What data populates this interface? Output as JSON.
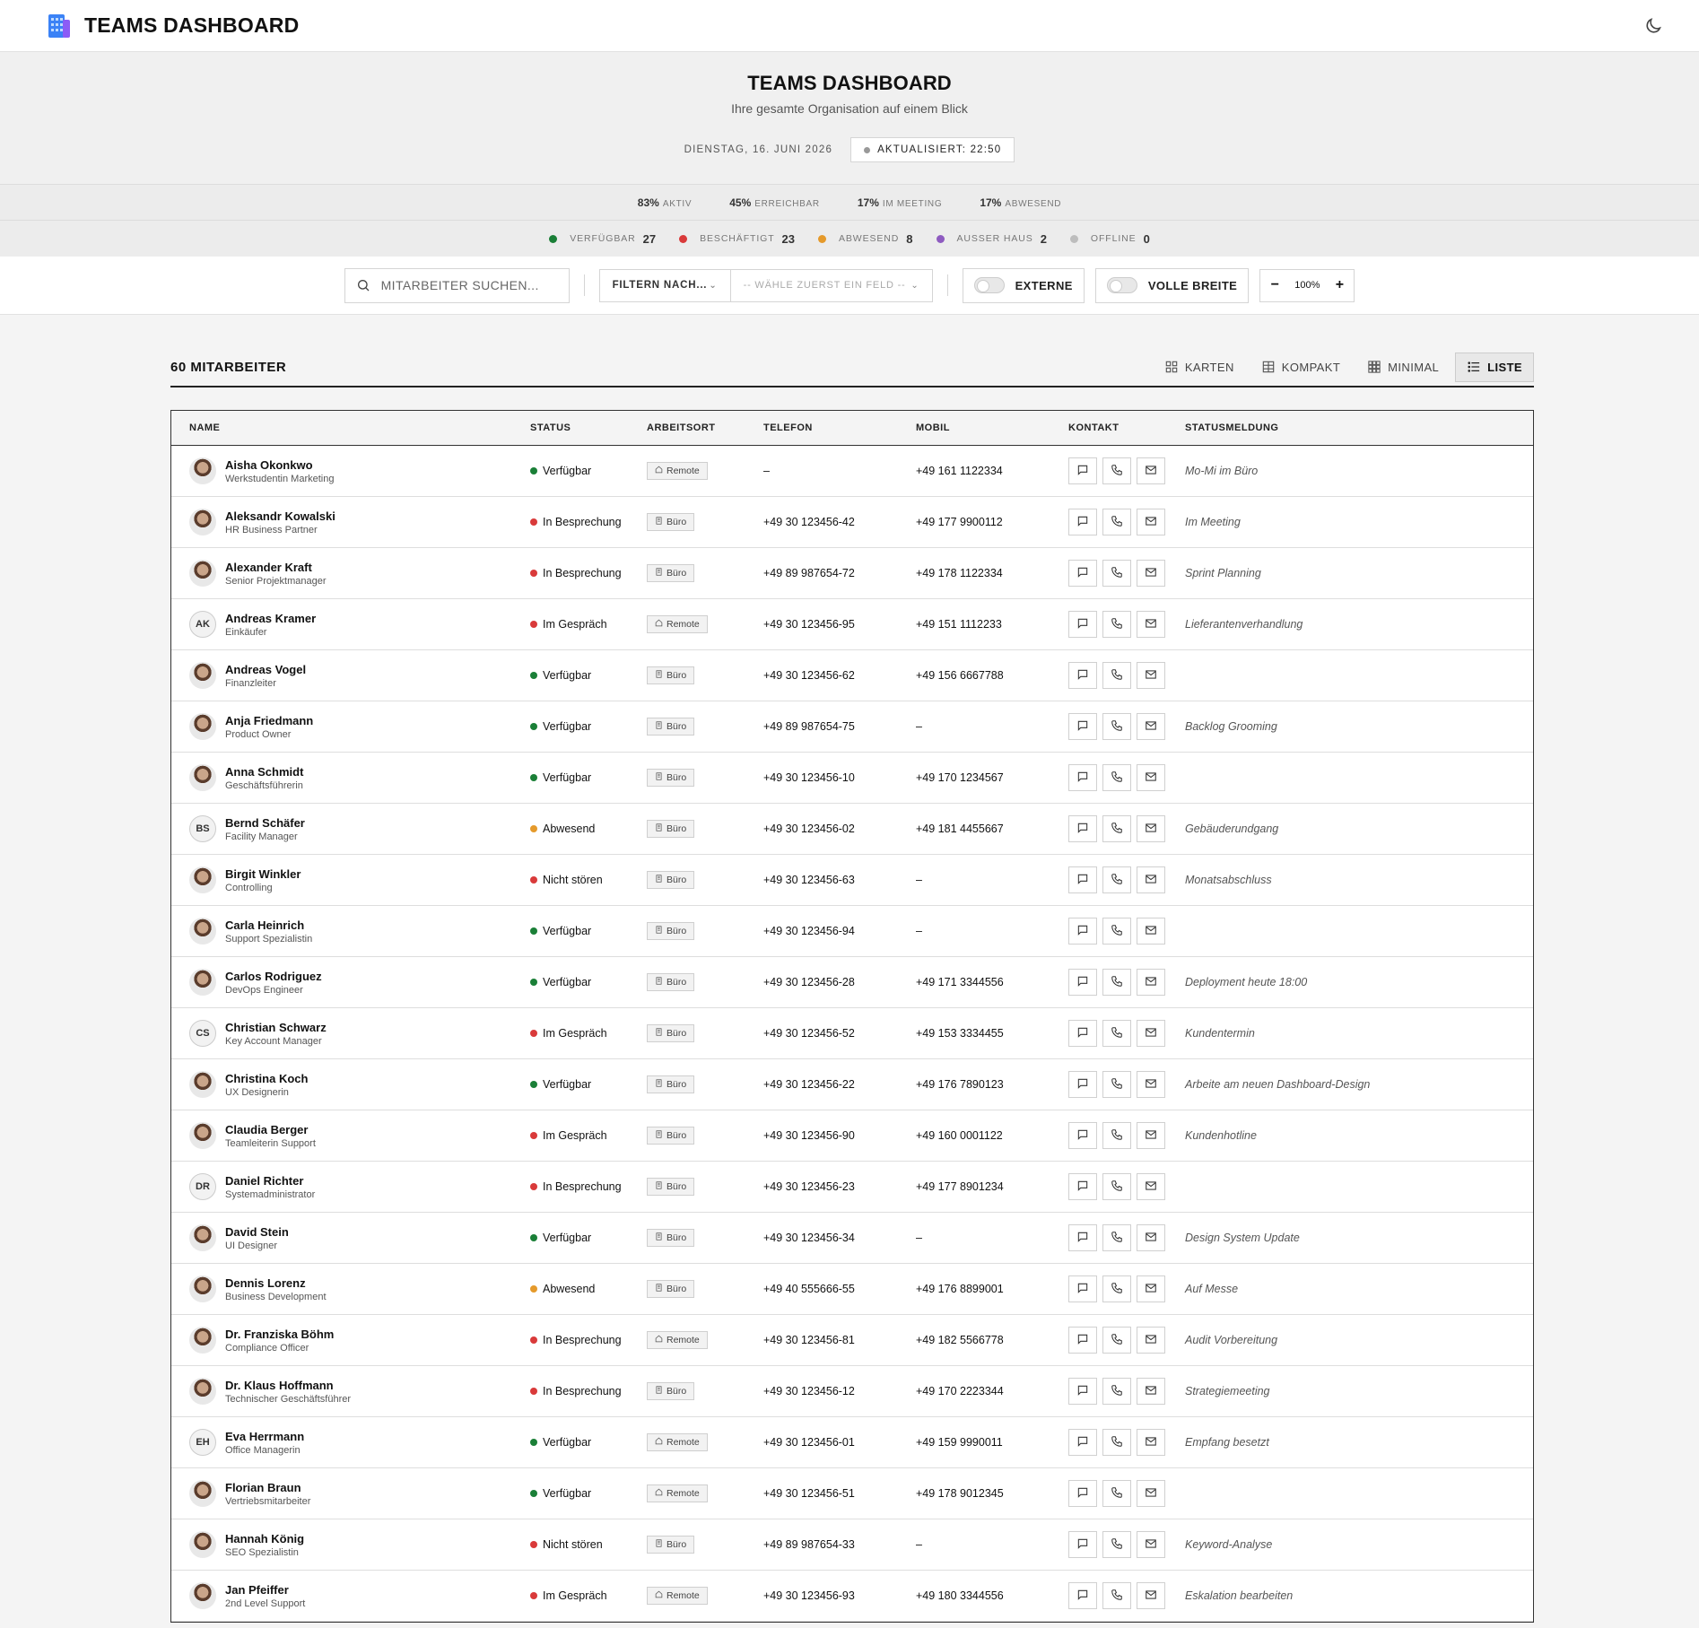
{
  "app": {
    "title": "TEAMS DASHBOARD"
  },
  "hero": {
    "title": "TEAMS DASHBOARD",
    "subtitle": "Ihre gesamte Organisation auf einem Blick",
    "date": "DIENSTAG, 16. JUNI 2026",
    "updated": "AKTUALISIERT: 22:50"
  },
  "stats": [
    {
      "pct": "83%",
      "label": "AKTIV"
    },
    {
      "pct": "45%",
      "label": "ERREICHBAR"
    },
    {
      "pct": "17%",
      "label": "IM MEETING"
    },
    {
      "pct": "17%",
      "label": "ABWESEND"
    }
  ],
  "status_counts": [
    {
      "label": "VERFÜGBAR",
      "count": "27",
      "color": "#1a7f37"
    },
    {
      "label": "BESCHÄFTIGT",
      "count": "23",
      "color": "#d93a3a"
    },
    {
      "label": "ABWESEND",
      "count": "8",
      "color": "#e59a2b"
    },
    {
      "label": "AUSSER HAUS",
      "count": "2",
      "color": "#8e5bc0"
    },
    {
      "label": "OFFLINE",
      "count": "0",
      "color": "#bdbdbd"
    }
  ],
  "toolbar": {
    "search_placeholder": "MITARBEITER SUCHEN...",
    "filter_label": "FILTERN NACH...",
    "filter_value": "-- WÄHLE ZUERST EIN FELD --",
    "externe_label": "EXTERNE",
    "fullwidth_label": "VOLLE BREITE",
    "zoom": "100%",
    "zoom_minus": "−",
    "zoom_plus": "+"
  },
  "list": {
    "count_label": "60 MITARBEITER",
    "views": [
      "KARTEN",
      "KOMPAKT",
      "MINIMAL",
      "LISTE"
    ],
    "active_view": "LISTE",
    "columns": [
      "NAME",
      "STATUS",
      "ARBEITSORT",
      "TELEFON",
      "MOBIL",
      "KONTAKT",
      "STATUSMELDUNG"
    ]
  },
  "status_colors": {
    "Verfügbar": "#1a7f37",
    "In Besprechung": "#d93a3a",
    "Im Gespräch": "#d93a3a",
    "Nicht stören": "#d93a3a",
    "Abwesend": "#e59a2b"
  },
  "rows": [
    {
      "name": "Aisha Okonkwo",
      "role": "Werkstudentin Marketing",
      "avatar": "photo",
      "initials": "",
      "status": "Verfügbar",
      "ort": "Remote",
      "tel": "–",
      "mob": "+49 161 1122334",
      "msg": "Mo-Mi im Büro"
    },
    {
      "name": "Aleksandr Kowalski",
      "role": "HR Business Partner",
      "avatar": "photo",
      "initials": "",
      "status": "In Besprechung",
      "ort": "Büro",
      "tel": "+49 30 123456-42",
      "mob": "+49 177 9900112",
      "msg": "Im Meeting"
    },
    {
      "name": "Alexander Kraft",
      "role": "Senior Projektmanager",
      "avatar": "photo",
      "initials": "",
      "status": "In Besprechung",
      "ort": "Büro",
      "tel": "+49 89 987654-72",
      "mob": "+49 178 1122334",
      "msg": "Sprint Planning"
    },
    {
      "name": "Andreas Kramer",
      "role": "Einkäufer",
      "avatar": "initials",
      "initials": "AK",
      "status": "Im Gespräch",
      "ort": "Remote",
      "tel": "+49 30 123456-95",
      "mob": "+49 151 1112233",
      "msg": "Lieferantenverhandlung"
    },
    {
      "name": "Andreas Vogel",
      "role": "Finanzleiter",
      "avatar": "photo",
      "initials": "",
      "status": "Verfügbar",
      "ort": "Büro",
      "tel": "+49 30 123456-62",
      "mob": "+49 156 6667788",
      "msg": ""
    },
    {
      "name": "Anja Friedmann",
      "role": "Product Owner",
      "avatar": "photo",
      "initials": "",
      "status": "Verfügbar",
      "ort": "Büro",
      "tel": "+49 89 987654-75",
      "mob": "–",
      "msg": "Backlog Grooming"
    },
    {
      "name": "Anna Schmidt",
      "role": "Geschäftsführerin",
      "avatar": "photo",
      "initials": "",
      "status": "Verfügbar",
      "ort": "Büro",
      "tel": "+49 30 123456-10",
      "mob": "+49 170 1234567",
      "msg": ""
    },
    {
      "name": "Bernd Schäfer",
      "role": "Facility Manager",
      "avatar": "initials",
      "initials": "BS",
      "status": "Abwesend",
      "ort": "Büro",
      "tel": "+49 30 123456-02",
      "mob": "+49 181 4455667",
      "msg": "Gebäuderundgang"
    },
    {
      "name": "Birgit Winkler",
      "role": "Controlling",
      "avatar": "photo",
      "initials": "",
      "status": "Nicht stören",
      "ort": "Büro",
      "tel": "+49 30 123456-63",
      "mob": "–",
      "msg": "Monatsabschluss"
    },
    {
      "name": "Carla Heinrich",
      "role": "Support Spezialistin",
      "avatar": "photo",
      "initials": "",
      "status": "Verfügbar",
      "ort": "Büro",
      "tel": "+49 30 123456-94",
      "mob": "–",
      "msg": ""
    },
    {
      "name": "Carlos Rodriguez",
      "role": "DevOps Engineer",
      "avatar": "photo",
      "initials": "",
      "status": "Verfügbar",
      "ort": "Büro",
      "tel": "+49 30 123456-28",
      "mob": "+49 171 3344556",
      "msg": "Deployment heute 18:00"
    },
    {
      "name": "Christian Schwarz",
      "role": "Key Account Manager",
      "avatar": "initials",
      "initials": "CS",
      "status": "Im Gespräch",
      "ort": "Büro",
      "tel": "+49 30 123456-52",
      "mob": "+49 153 3334455",
      "msg": "Kundentermin"
    },
    {
      "name": "Christina Koch",
      "role": "UX Designerin",
      "avatar": "photo",
      "initials": "",
      "status": "Verfügbar",
      "ort": "Büro",
      "tel": "+49 30 123456-22",
      "mob": "+49 176 7890123",
      "msg": "Arbeite am neuen Dashboard-Design"
    },
    {
      "name": "Claudia Berger",
      "role": "Teamleiterin Support",
      "avatar": "photo",
      "initials": "",
      "status": "Im Gespräch",
      "ort": "Büro",
      "tel": "+49 30 123456-90",
      "mob": "+49 160 0001122",
      "msg": "Kundenhotline"
    },
    {
      "name": "Daniel Richter",
      "role": "Systemadministrator",
      "avatar": "initials",
      "initials": "DR",
      "status": "In Besprechung",
      "ort": "Büro",
      "tel": "+49 30 123456-23",
      "mob": "+49 177 8901234",
      "msg": ""
    },
    {
      "name": "David Stein",
      "role": "UI Designer",
      "avatar": "photo",
      "initials": "",
      "status": "Verfügbar",
      "ort": "Büro",
      "tel": "+49 30 123456-34",
      "mob": "–",
      "msg": "Design System Update"
    },
    {
      "name": "Dennis Lorenz",
      "role": "Business Development",
      "avatar": "photo",
      "initials": "",
      "status": "Abwesend",
      "ort": "Büro",
      "tel": "+49 40 555666-55",
      "mob": "+49 176 8899001",
      "msg": "Auf Messe"
    },
    {
      "name": "Dr. Franziska Böhm",
      "role": "Compliance Officer",
      "avatar": "photo",
      "initials": "",
      "status": "In Besprechung",
      "ort": "Remote",
      "tel": "+49 30 123456-81",
      "mob": "+49 182 5566778",
      "msg": "Audit Vorbereitung"
    },
    {
      "name": "Dr. Klaus Hoffmann",
      "role": "Technischer Geschäftsführer",
      "avatar": "photo",
      "initials": "",
      "status": "In Besprechung",
      "ort": "Büro",
      "tel": "+49 30 123456-12",
      "mob": "+49 170 2223344",
      "msg": "Strategiemeeting"
    },
    {
      "name": "Eva Herrmann",
      "role": "Office Managerin",
      "avatar": "initials",
      "initials": "EH",
      "status": "Verfügbar",
      "ort": "Remote",
      "tel": "+49 30 123456-01",
      "mob": "+49 159 9990011",
      "msg": "Empfang besetzt"
    },
    {
      "name": "Florian Braun",
      "role": "Vertriebsmitarbeiter",
      "avatar": "photo",
      "initials": "",
      "status": "Verfügbar",
      "ort": "Remote",
      "tel": "+49 30 123456-51",
      "mob": "+49 178 9012345",
      "msg": ""
    },
    {
      "name": "Hannah König",
      "role": "SEO Spezialistin",
      "avatar": "photo",
      "initials": "",
      "status": "Nicht stören",
      "ort": "Büro",
      "tel": "+49 89 987654-33",
      "mob": "–",
      "msg": "Keyword-Analyse"
    },
    {
      "name": "Jan Pfeiffer",
      "role": "2nd Level Support",
      "avatar": "photo",
      "initials": "",
      "status": "Im Gespräch",
      "ort": "Remote",
      "tel": "+49 30 123456-93",
      "mob": "+49 180 3344556",
      "msg": "Eskalation bearbeiten"
    }
  ]
}
